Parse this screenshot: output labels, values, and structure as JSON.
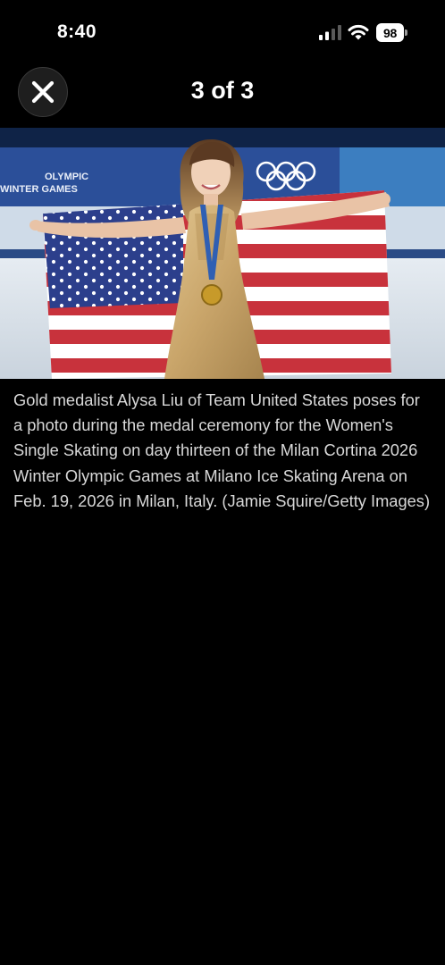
{
  "status_bar": {
    "time": "8:40",
    "battery_level": "98",
    "icons": [
      "cellular-signal-icon",
      "wifi-icon",
      "battery-icon"
    ]
  },
  "header": {
    "close_icon": "close-icon",
    "page_counter": "3 of 3"
  },
  "photo": {
    "subject": "figure-skater-with-us-flag",
    "banner_text": "OLYMPIC\nWINTER GAMES",
    "colors": {
      "flag_red": "#c8323c",
      "flag_blue": "#2c3f8c",
      "dress_gold": "#c9a56a",
      "banner_blue": "#2b4f99"
    }
  },
  "caption": {
    "text": "Gold medalist Alysa Liu of Team United States poses for a photo during the medal ceremony for the Women's Single Skating on day thirteen of the Milan Cortina 2026 Winter Olympic Games at Milano Ice Skating Arena on Feb. 19, 2026 in Milan, Italy. (Jamie Squire/Getty Images)"
  }
}
